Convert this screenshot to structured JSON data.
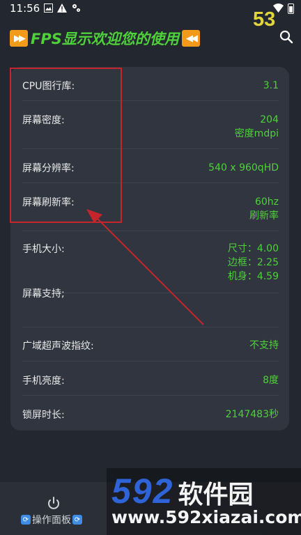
{
  "status_bar": {
    "time": "11:56"
  },
  "fps": "53",
  "header": {
    "title": "FPS显示欢迎您的使用"
  },
  "rows": [
    {
      "label": "CPU图行库:",
      "values": [
        "3.1"
      ]
    },
    {
      "label": "屏幕密度:",
      "values": [
        "204",
        "密度mdpi"
      ]
    },
    {
      "label": "屏幕分辨率:",
      "values": [
        "540 x 960qHD"
      ]
    },
    {
      "label": "屏幕刷新率:",
      "values": [
        "60hz",
        "刷新率"
      ]
    },
    {
      "label": "手机大小:",
      "values": [
        "尺寸：4.00",
        "边框：2.25",
        "机身：4.59"
      ]
    },
    {
      "label": "屏幕支持;",
      "values": []
    },
    {
      "label": "广域超声波指纹:",
      "values": [
        "不支持"
      ]
    },
    {
      "label": "手机亮度:",
      "values": [
        "8度"
      ]
    },
    {
      "label": "锁屏时长:",
      "values": [
        "2147483秒"
      ]
    }
  ],
  "bottom_nav": {
    "label": "操作面板"
  },
  "watermark": {
    "num": "592",
    "cn": "软件园",
    "url": "www.592xiazai.com"
  },
  "colors": {
    "value_green": "#4fd13a",
    "fps_yellow": "#e0d53c",
    "annotation_red": "#c6262b",
    "watermark_blue": "#2f64d8"
  },
  "icons": [
    "image-icon",
    "warning-icon",
    "gear-icon",
    "wifi-icon",
    "battery-icon",
    "fast-forward-icon",
    "rewind-icon",
    "search-icon",
    "power-icon",
    "refresh-icon"
  ]
}
